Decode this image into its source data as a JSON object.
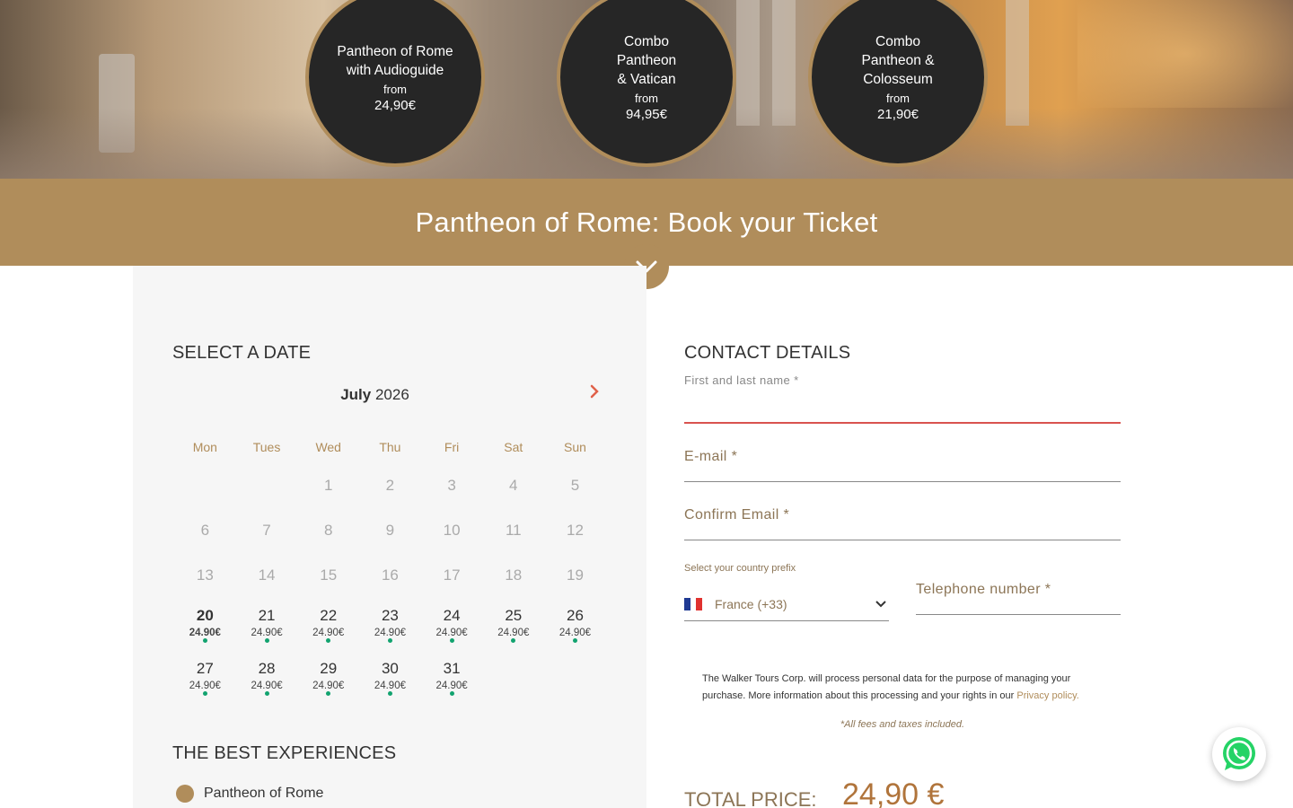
{
  "hero": {
    "products": [
      {
        "title": "Pantheon of Rome with Audioguide",
        "from": "from",
        "price": "24,90€"
      },
      {
        "title": "Combo Pantheon & Vatican",
        "from": "from",
        "price": "94,95€"
      },
      {
        "title": "Combo Pantheon & Colosseum",
        "from": "from",
        "price": "21,90€"
      }
    ]
  },
  "banner": {
    "title": "Pantheon of Rome: Book your Ticket"
  },
  "calendar": {
    "section_title": "SELECT A DATE",
    "month": "July",
    "year": "2026",
    "weekdays": [
      "Mon",
      "Tues",
      "Wed",
      "Thu",
      "Fri",
      "Sat",
      "Sun"
    ],
    "disabled_days": [
      "1",
      "2",
      "3",
      "4",
      "5",
      "6",
      "7",
      "8",
      "9",
      "10",
      "11",
      "12",
      "13",
      "14",
      "15",
      "16",
      "17",
      "18",
      "19"
    ],
    "available_days": [
      {
        "day": "20",
        "price": "24.90€",
        "selected": true
      },
      {
        "day": "21",
        "price": "24.90€"
      },
      {
        "day": "22",
        "price": "24.90€"
      },
      {
        "day": "23",
        "price": "24.90€"
      },
      {
        "day": "24",
        "price": "24.90€"
      },
      {
        "day": "25",
        "price": "24.90€"
      },
      {
        "day": "26",
        "price": "24.90€"
      },
      {
        "day": "27",
        "price": "24.90€"
      },
      {
        "day": "28",
        "price": "24.90€"
      },
      {
        "day": "29",
        "price": "24.90€"
      },
      {
        "day": "30",
        "price": "24.90€"
      },
      {
        "day": "31",
        "price": "24.90€"
      }
    ]
  },
  "experiences": {
    "section_title": "THE BEST EXPERIENCES",
    "items": [
      "Pantheon of Rome"
    ]
  },
  "contact": {
    "section_title": "CONTACT DETAILS",
    "name_label": "First and last name *",
    "email_label": "E-mail *",
    "confirm_email_label": "Confirm Email *",
    "prefix_label": "Select your country prefix",
    "prefix_value": "France (+33)",
    "phone_label": "Telephone number *",
    "legal_text": "The Walker Tours Corp. will process personal data for the purpose of managing your purchase. More information about this processing and your rights in our",
    "privacy_link": "Privacy policy.",
    "fees_note": "*All fees and taxes included."
  },
  "total": {
    "label": "TOTAL PRICE:",
    "value": "24,90 €"
  },
  "colors": {
    "accent": "#b08d5b",
    "available_dot": "#12a36f",
    "bubble_bg": "#262626"
  },
  "icons": [
    "chevron-down-icon",
    "chevron-right-icon",
    "whatsapp-icon",
    "france-flag-icon"
  ]
}
